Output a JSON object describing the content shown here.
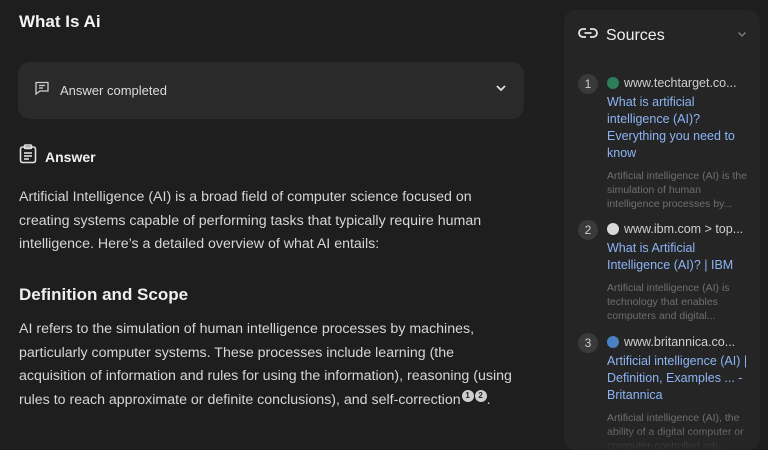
{
  "page_title": "What Is Ai",
  "status": {
    "label": "Answer completed"
  },
  "answer": {
    "heading": "Answer",
    "intro": "Artificial Intelligence (AI) is a broad field of computer science focused on creating systems capable of performing tasks that typically require human intelligence. Here’s a detailed overview of what AI entails:",
    "section_heading": "Definition and Scope",
    "section_text": "AI refers to the simulation of human intelligence processes by machines, particularly computer systems. These processes include learning (the acquisition of information and rules for using the information), reasoning (using rules to reach approximate or definite conclusions), and self-correction",
    "citations": [
      "1",
      "2"
    ],
    "trailing": "."
  },
  "sources": {
    "title": "Sources",
    "items": [
      {
        "num": "1",
        "domain": "www.techtarget.co...",
        "title": "What is artificial intelligence (AI)? Everything you need to know",
        "snippet": "Artificial intelligence (AI) is the simulation of human intelligence processes by...",
        "favicon_color": "#2e7d5b"
      },
      {
        "num": "2",
        "domain": "www.ibm.com > top...",
        "title": "What is Artificial Intelligence (AI)? | IBM",
        "snippet": "Artificial intelligence (AI) is technology that enables computers and digital...",
        "favicon_color": "#d9d9d9"
      },
      {
        "num": "3",
        "domain": "www.britannica.co...",
        "title": "Artificial intelligence (AI) | Definition, Examples ... - Britannica",
        "snippet": "Artificial intelligence (AI), the ability of a digital computer or computer-controlled rob...",
        "favicon_color": "#4a7fc1"
      }
    ]
  }
}
